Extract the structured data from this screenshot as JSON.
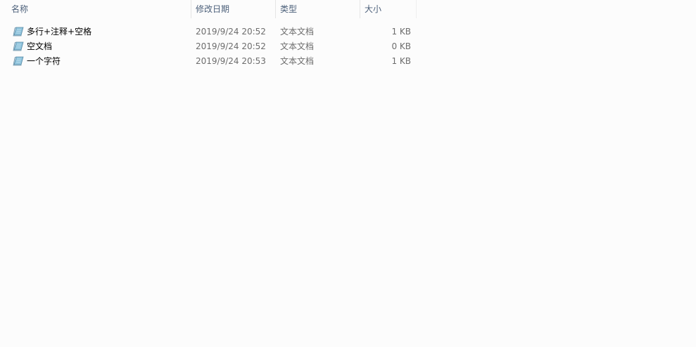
{
  "columns": {
    "name": "名称",
    "date": "修改日期",
    "type": "类型",
    "size": "大小"
  },
  "sort_indicator": "up-caret-icon",
  "files": [
    {
      "name": "多行+注释+空格",
      "date": "2019/9/24 20:52",
      "type": "文本文档",
      "size": "1 KB",
      "icon": "text-file-icon"
    },
    {
      "name": "空文档",
      "date": "2019/9/24 20:52",
      "type": "文本文档",
      "size": "0 KB",
      "icon": "text-file-icon"
    },
    {
      "name": "一个字符",
      "date": "2019/9/24 20:53",
      "type": "文本文档",
      "size": "1 KB",
      "icon": "text-file-icon"
    }
  ],
  "colors": {
    "background": "#fcfcfc",
    "header_text": "#4c607a",
    "sort_arrow": "#3c7fb1",
    "icon_fill": "#8ec3dc"
  }
}
